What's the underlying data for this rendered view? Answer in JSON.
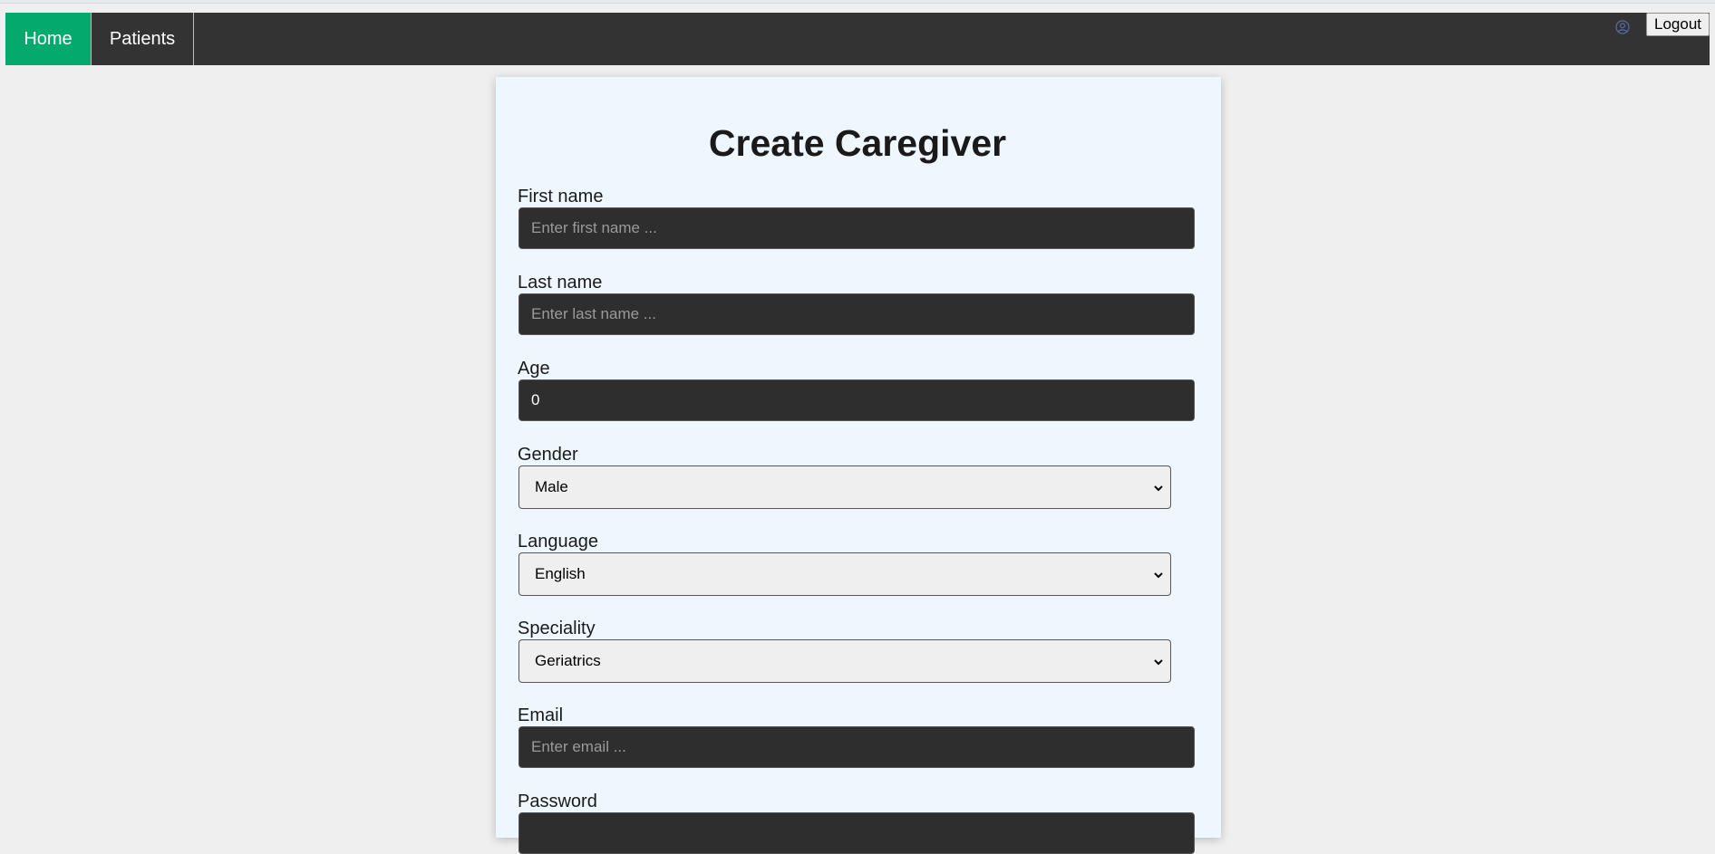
{
  "nav": {
    "home": "Home",
    "patients": "Patients",
    "logout": "Logout",
    "user_icon": "user-circle-icon"
  },
  "form": {
    "title": "Create Caregiver",
    "first_name": {
      "label": "First name",
      "placeholder": "Enter first name ...",
      "value": ""
    },
    "last_name": {
      "label": "Last name",
      "placeholder": "Enter last name ...",
      "value": ""
    },
    "age": {
      "label": "Age",
      "value": "0"
    },
    "gender": {
      "label": "Gender",
      "selected": "Male"
    },
    "language": {
      "label": "Language",
      "selected": "English"
    },
    "speciality": {
      "label": "Speciality",
      "selected": "Geriatrics"
    },
    "email": {
      "label": "Email",
      "placeholder": "Enter email ...",
      "value": ""
    },
    "password": {
      "label": "Password"
    }
  },
  "colors": {
    "nav_background": "#333333",
    "active_tab": "#04aa6d",
    "card_background": "#eff7fe",
    "input_background": "#2e2e2e"
  }
}
